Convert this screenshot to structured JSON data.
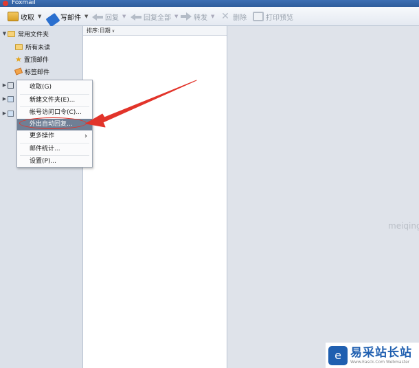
{
  "window": {
    "title": "Foxmail"
  },
  "toolbar": {
    "receive": "收取",
    "compose": "写邮件",
    "reply": "回复",
    "reply_all": "回复全部",
    "forward": "转发",
    "delete": "删除",
    "print_preview": "打印预览"
  },
  "sidebar": {
    "group_label": "常用文件夹",
    "items": [
      {
        "label": "所有未读",
        "icon": "folder-icon"
      },
      {
        "label": "置顶邮件",
        "icon": "star-icon"
      },
      {
        "label": "标签邮件",
        "icon": "tag-icon"
      }
    ]
  },
  "list": {
    "sort_label": "排序:日期"
  },
  "context_menu": {
    "items": [
      {
        "label": "收取(G)"
      },
      {
        "label": "新建文件夹(E)..."
      },
      {
        "label": "帐号访问口令(C)..."
      },
      {
        "label": "外出自动回复...",
        "highlighted": true
      },
      {
        "label": "更多操作",
        "submenu": true
      },
      {
        "label": "邮件统计..."
      },
      {
        "label": "设置(P)..."
      }
    ],
    "submenu_glyph": "›"
  },
  "watermark": {
    "text": "meiqing"
  },
  "brand": {
    "name": "易采站长站",
    "url": "Www.Easck.Com Webmaster",
    "logo_glyph": "e"
  },
  "colors": {
    "annotation_red": "#e2342a",
    "menu_highlight": "#6f7f95",
    "titlebar": "#3d6fb3"
  }
}
